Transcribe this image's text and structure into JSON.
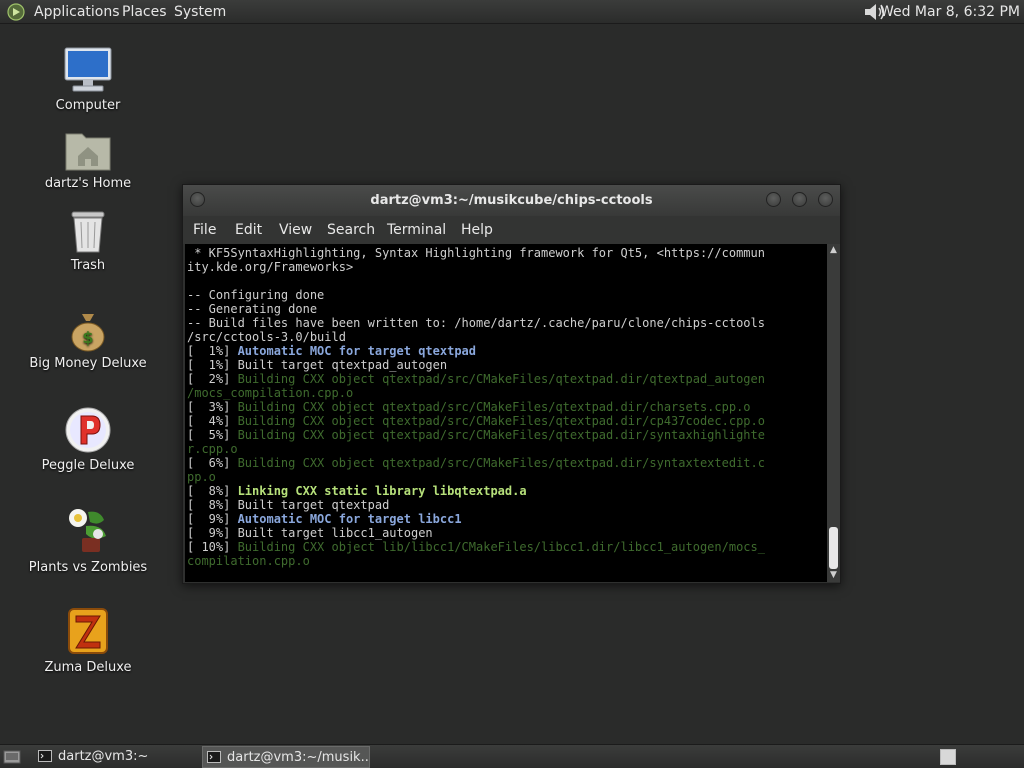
{
  "top_panel": {
    "menus": [
      "Applications",
      "Places",
      "System"
    ],
    "clock": "Wed Mar  8,  6:32 PM",
    "logo_icon": "gnome-foot-icon",
    "volume_icon": "speaker-icon"
  },
  "desktop": {
    "icons": [
      {
        "label": "Computer",
        "icon": "computer-icon"
      },
      {
        "label": "dartz's Home",
        "icon": "home-folder-icon"
      },
      {
        "label": "Trash",
        "icon": "trash-icon"
      },
      {
        "label": "Big Money Deluxe",
        "icon": "money-bag-icon"
      },
      {
        "label": "Peggle Deluxe",
        "icon": "peggle-icon"
      },
      {
        "label": "Plants vs Zombies",
        "icon": "plants-icon"
      },
      {
        "label": "Zuma Deluxe",
        "icon": "zuma-icon"
      }
    ]
  },
  "terminal": {
    "title": "dartz@vm3:~/musikcube/chips-cctools",
    "menu": [
      "File",
      "Edit",
      "View",
      "Search",
      "Terminal",
      "Help"
    ],
    "lines": [
      {
        "text": " * KF5SyntaxHighlighting, Syntax Highlighting framework for Qt5, <https://commun",
        "style": ""
      },
      {
        "text": "ity.kde.org/Frameworks>",
        "style": ""
      },
      {
        "text": "",
        "style": ""
      },
      {
        "text": "-- Configuring done",
        "style": ""
      },
      {
        "text": "-- Generating done",
        "style": ""
      },
      {
        "text": "-- Build files have been written to: /home/dartz/.cache/paru/clone/chips-cctools",
        "style": ""
      },
      {
        "text": "/src/cctools-3.0/build",
        "style": ""
      },
      {
        "prefix": "[  1%] ",
        "text": "Automatic MOC for target qtextpad",
        "style": "blue"
      },
      {
        "text": "[  1%] Built target qtextpad_autogen",
        "style": ""
      },
      {
        "prefix": "[  2%] ",
        "text": "Building CXX object qtextpad/src/CMakeFiles/qtextpad.dir/qtextpad_autogen",
        "style": "dim"
      },
      {
        "text": "/mocs_compilation.cpp.o",
        "style": "dim"
      },
      {
        "prefix": "[  3%] ",
        "text": "Building CXX object qtextpad/src/CMakeFiles/qtextpad.dir/charsets.cpp.o",
        "style": "dim"
      },
      {
        "prefix": "[  4%] ",
        "text": "Building CXX object qtextpad/src/CMakeFiles/qtextpad.dir/cp437codec.cpp.o",
        "style": "dim"
      },
      {
        "prefix": "[  5%] ",
        "text": "Building CXX object qtextpad/src/CMakeFiles/qtextpad.dir/syntaxhighlighte",
        "style": "dim"
      },
      {
        "text": "r.cpp.o",
        "style": "dim"
      },
      {
        "prefix": "[  6%] ",
        "text": "Building CXX object qtextpad/src/CMakeFiles/qtextpad.dir/syntaxtextedit.c",
        "style": "dim"
      },
      {
        "text": "pp.o",
        "style": "dim"
      },
      {
        "prefix": "[  8%] ",
        "text": "Linking CXX static library libqtextpad.a",
        "style": "green"
      },
      {
        "text": "[  8%] Built target qtextpad",
        "style": ""
      },
      {
        "prefix": "[  9%] ",
        "text": "Automatic MOC for target libcc1",
        "style": "blue"
      },
      {
        "text": "[  9%] Built target libcc1_autogen",
        "style": ""
      },
      {
        "prefix": "[ 10%] ",
        "text": "Building CXX object lib/libcc1/CMakeFiles/libcc1.dir/libcc1_autogen/mocs_",
        "style": "dim"
      },
      {
        "text": "compilation.cpp.o",
        "style": "dim"
      }
    ]
  },
  "taskbar": {
    "tasks": [
      {
        "label": "dartz@vm3:~",
        "active": false
      },
      {
        "label": "dartz@vm3:~/musik...",
        "active": true
      }
    ]
  }
}
